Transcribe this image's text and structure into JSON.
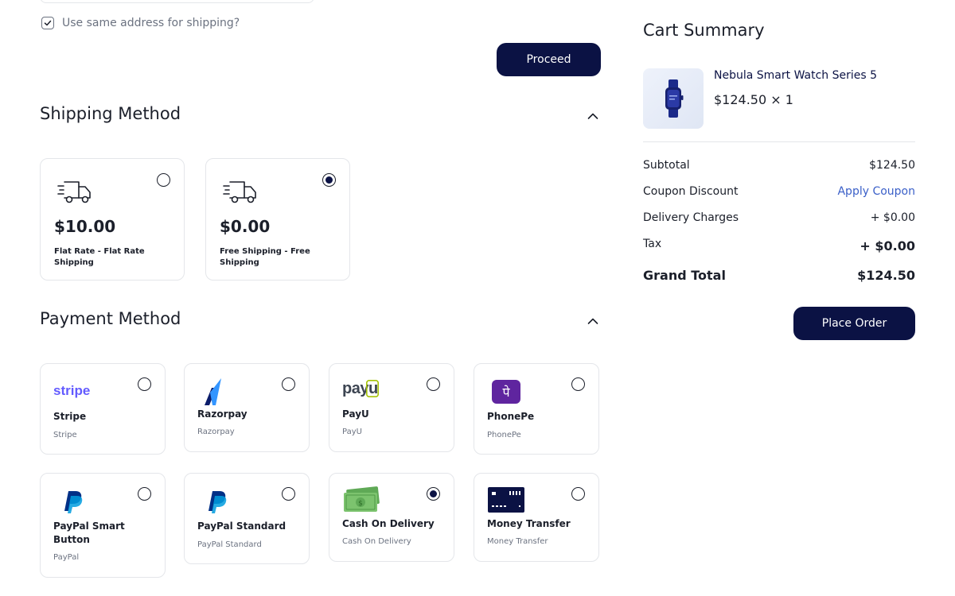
{
  "checkout": {
    "same_address_label": "Use same address for shipping?",
    "same_address_checked": true,
    "proceed_label": "Proceed"
  },
  "shipping": {
    "title": "Shipping Method",
    "options": [
      {
        "price": "$10.00",
        "label": "Flat Rate - Flat Rate Shipping",
        "selected": false
      },
      {
        "price": "$0.00",
        "label": "Free Shipping - Free Shipping",
        "selected": true
      }
    ]
  },
  "payment": {
    "title": "Payment Method",
    "options": [
      {
        "logo_text": "stripe",
        "name": "Stripe",
        "sub": "Stripe",
        "selected": false
      },
      {
        "logo_text": "",
        "name": "Razorpay",
        "sub": "Razorpay",
        "selected": false
      },
      {
        "logo_text": "payu",
        "name": "PayU",
        "sub": "PayU",
        "selected": false
      },
      {
        "logo_text": "पे",
        "name": "PhonePe",
        "sub": "PhonePe",
        "selected": false
      },
      {
        "logo_text": "P",
        "name": "PayPal Smart Button",
        "sub": "PayPal",
        "selected": false
      },
      {
        "logo_text": "P",
        "name": "PayPal Standard",
        "sub": "PayPal Standard",
        "selected": false
      },
      {
        "logo_text": "",
        "name": "Cash On Delivery",
        "sub": "Cash On Delivery",
        "selected": true
      },
      {
        "logo_text": "",
        "name": "Money Transfer",
        "sub": "Money Transfer",
        "selected": false
      }
    ]
  },
  "summary": {
    "title": "Cart Summary",
    "product": {
      "name": "Nebula Smart Watch Series 5",
      "price_qty": "$124.50 × 1"
    },
    "subtotal_label": "Subtotal",
    "subtotal_value": "$124.50",
    "coupon_label": "Coupon Discount",
    "coupon_action": "Apply Coupon",
    "delivery_label": "Delivery Charges",
    "delivery_value": "+ $0.00",
    "tax_label": "Tax",
    "tax_value": "+ $0.00",
    "grand_total_label": "Grand Total",
    "grand_total_value": "$124.50",
    "place_order_label": "Place Order"
  },
  "colors": {
    "primary": "#0b1244",
    "link": "#3a5fc8",
    "border": "#e4e6ea",
    "muted": "#6b7280"
  },
  "icons": [
    "check-icon",
    "chevron-up-icon",
    "delivery-truck-icon",
    "stripe-logo",
    "razorpay-logo",
    "payu-logo",
    "phonepe-logo",
    "paypal-logo",
    "cash-icon",
    "bank-card-icon",
    "smartwatch-image"
  ]
}
